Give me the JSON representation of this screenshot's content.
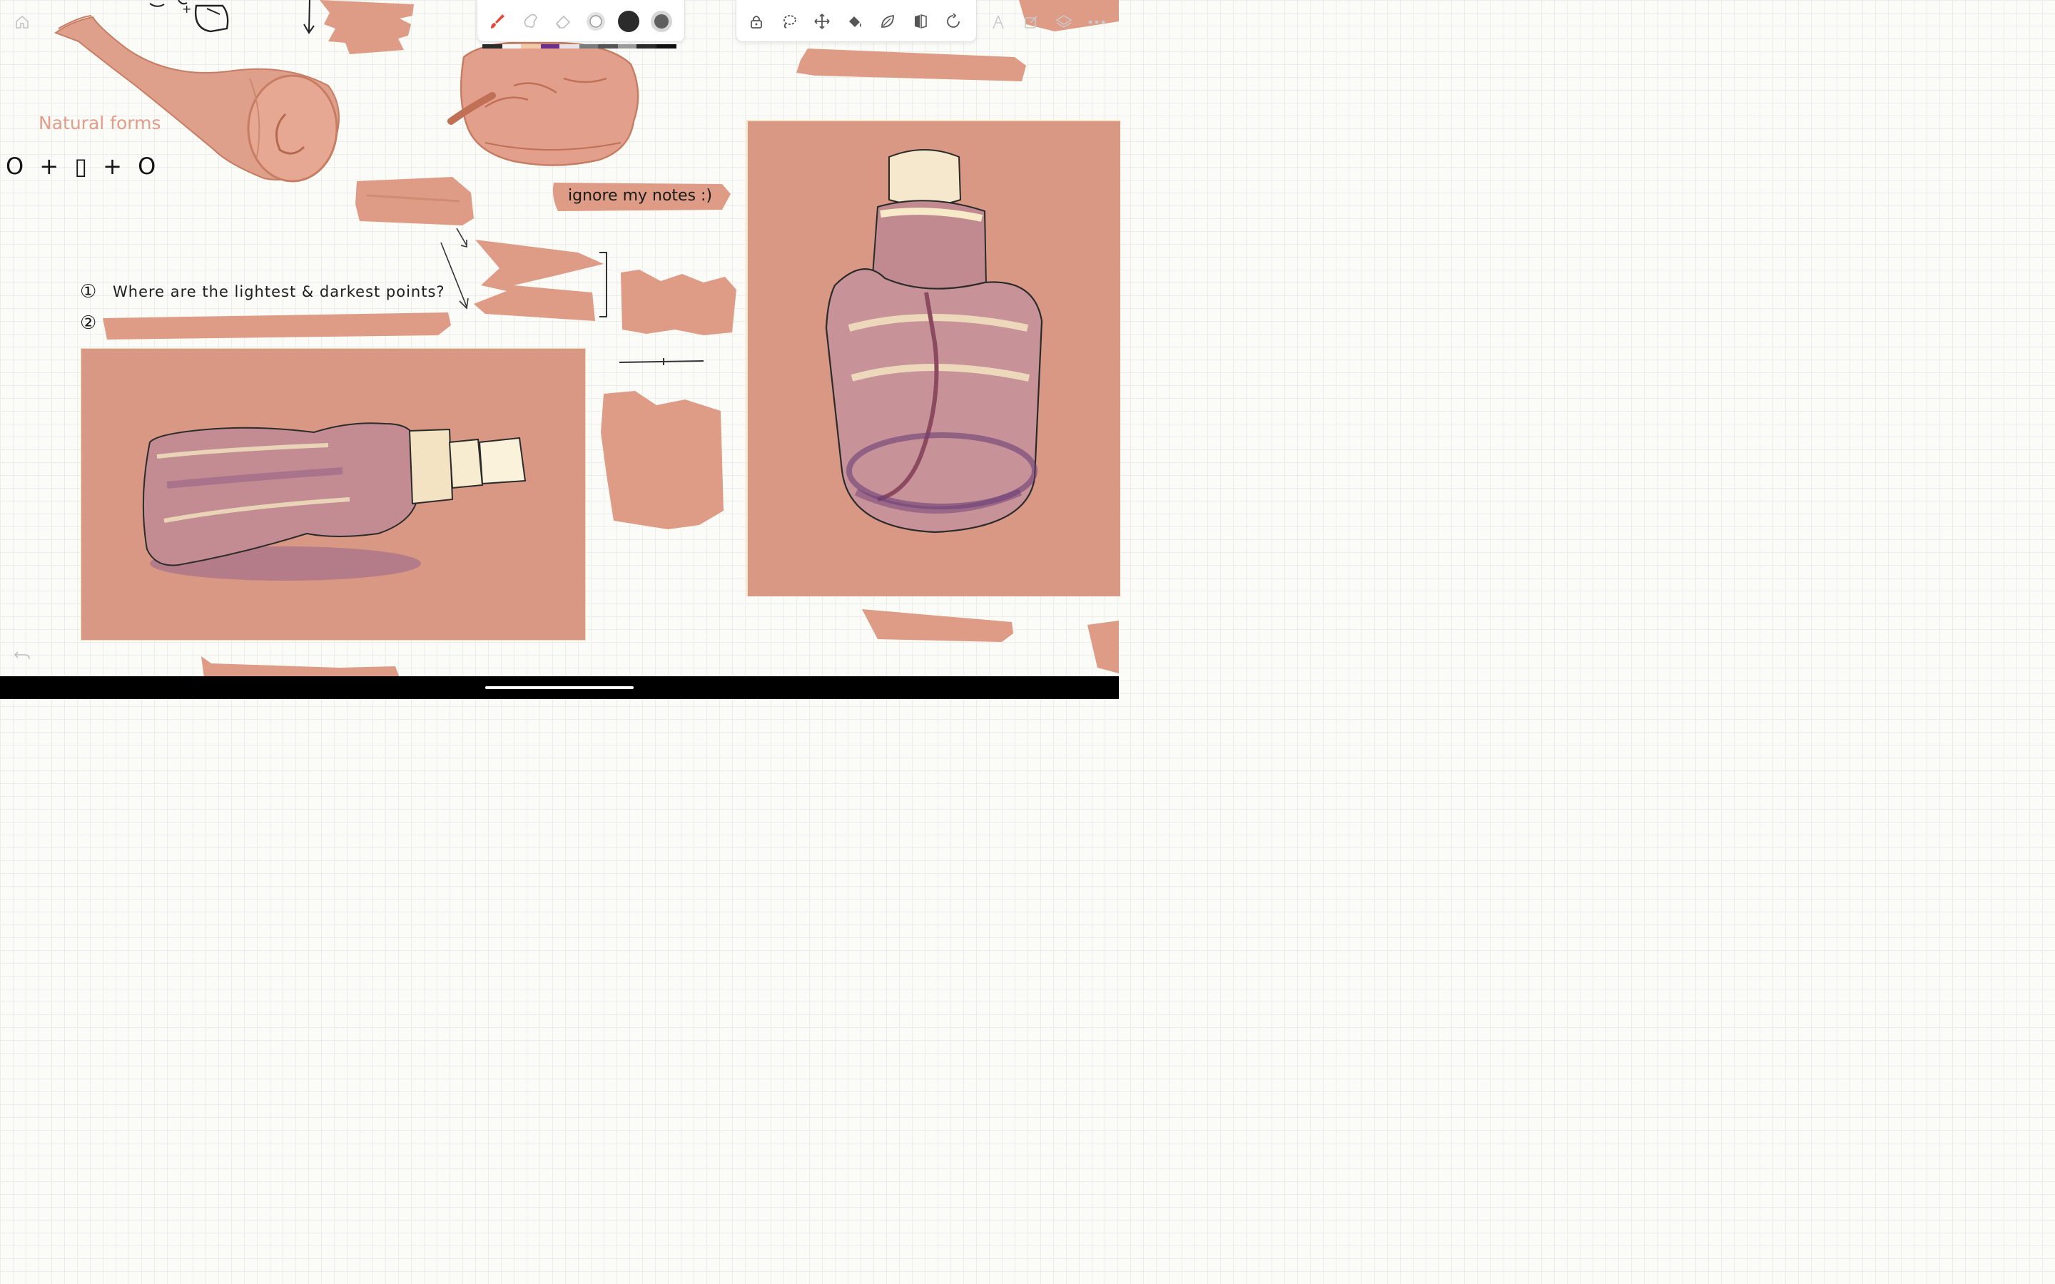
{
  "canvas": {
    "title_natural_forms": "Natural forms",
    "formula": "O + ▯ + O",
    "question_1_number": "①",
    "question_1_text": "Where are the lightest & darkest points?",
    "question_2_number": "②",
    "note_ignore": "ignore my notes :)"
  },
  "brush_toolbar": {
    "tools": [
      "brush-icon",
      "smudge-icon",
      "eraser-icon",
      "size-small-icon",
      "color-dark-icon",
      "opacity-icon"
    ],
    "palette_colors": [
      "#2b2b2b",
      "#f4f4f4",
      "#f1c9a6",
      "#6b2f8a",
      "#e9e0e8",
      "#7b7b7b",
      "#555555",
      "#9a9a9a",
      "#2a2a2a",
      "#111111"
    ]
  },
  "edit_toolbar": {
    "tools": [
      "lock-icon",
      "lasso-icon",
      "move-icon",
      "fill-icon",
      "leaf-icon",
      "mirror-icon",
      "rotate-icon"
    ]
  },
  "right_icons": [
    "ruler-icon",
    "edit-icon",
    "layers-icon",
    "more-icon"
  ],
  "colors": {
    "swatch": "#de9b85",
    "panel": "#d98f7d",
    "accent_red": "#e5473e"
  }
}
